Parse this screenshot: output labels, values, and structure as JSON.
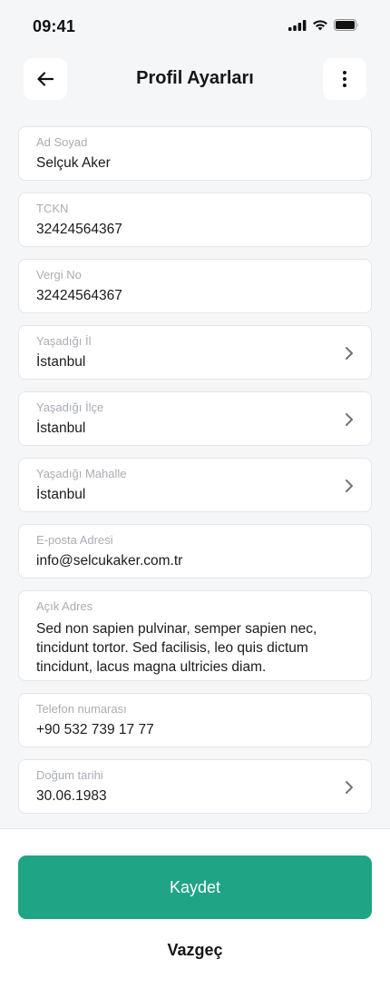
{
  "status_bar": {
    "time": "09:41"
  },
  "header": {
    "title": "Profil Ayarları",
    "back_icon": "arrow-left-icon",
    "more_icon": "more-vertical-icon"
  },
  "form": {
    "fields": [
      {
        "label": "Ad Soyad",
        "value": "Selçuk Aker"
      },
      {
        "label": "TCKN",
        "value": "32424564367"
      },
      {
        "label": "Vergi No",
        "value": "32424564367"
      },
      {
        "label": "Yaşadığı İl",
        "value": "İstanbul",
        "icon": "chevron-right-icon"
      },
      {
        "label": "Yaşadığı İlçe",
        "value": "İstanbul",
        "icon": "chevron-right-icon"
      },
      {
        "label": "Yaşadığı Mahalle",
        "value": "İstanbul",
        "icon": "chevron-right-icon"
      },
      {
        "label": "E-posta Adresi",
        "value": "info@selcukaker.com.tr"
      },
      {
        "label": "Açık Adres",
        "value": "Sed non sapien pulvinar, semper sapien nec, tincidunt tortor. Sed facilisis, leo quis dictum tincidunt, lacus magna ultricies diam."
      },
      {
        "label": "Telefon numarası",
        "value": "+90 532 739 17 77"
      },
      {
        "label": "Doğum tarihi",
        "value": "30.06.1983",
        "icon": "chevron-right-icon"
      }
    ]
  },
  "actions": {
    "save_label": "Kaydet",
    "cancel_label": "Vazgeç"
  },
  "colors": {
    "primary": "#20a486",
    "background": "#f5f6f8",
    "label": "#a9adb3"
  }
}
